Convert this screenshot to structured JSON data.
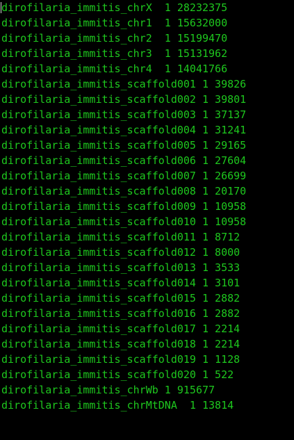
{
  "terminal": {
    "text_color": "#1ec81e",
    "background_color": "#000000",
    "lines": [
      "dirofilaria_immitis_chrX  1 28232375",
      "dirofilaria_immitis_chr1  1 15632000",
      "dirofilaria_immitis_chr2  1 15199470",
      "dirofilaria_immitis_chr3  1 15131962",
      "dirofilaria_immitis_chr4  1 14041766",
      "dirofilaria_immitis_scaffold001 1 39826",
      "dirofilaria_immitis_scaffold002 1 39801",
      "dirofilaria_immitis_scaffold003 1 37137",
      "dirofilaria_immitis_scaffold004 1 31241",
      "dirofilaria_immitis_scaffold005 1 29165",
      "dirofilaria_immitis_scaffold006 1 27604",
      "dirofilaria_immitis_scaffold007 1 26699",
      "dirofilaria_immitis_scaffold008 1 20170",
      "dirofilaria_immitis_scaffold009 1 10958",
      "dirofilaria_immitis_scaffold010 1 10958",
      "dirofilaria_immitis_scaffold011 1 8712",
      "dirofilaria_immitis_scaffold012 1 8000",
      "dirofilaria_immitis_scaffold013 1 3533",
      "dirofilaria_immitis_scaffold014 1 3101",
      "dirofilaria_immitis_scaffold015 1 2882",
      "dirofilaria_immitis_scaffold016 1 2882",
      "dirofilaria_immitis_scaffold017 1 2214",
      "dirofilaria_immitis_scaffold018 1 2214",
      "dirofilaria_immitis_scaffold019 1 1128",
      "dirofilaria_immitis_scaffold020 1 522",
      "dirofilaria_immitis_chrWb 1 915677",
      "dirofilaria_immitis_chrMtDNA  1 13814"
    ]
  }
}
